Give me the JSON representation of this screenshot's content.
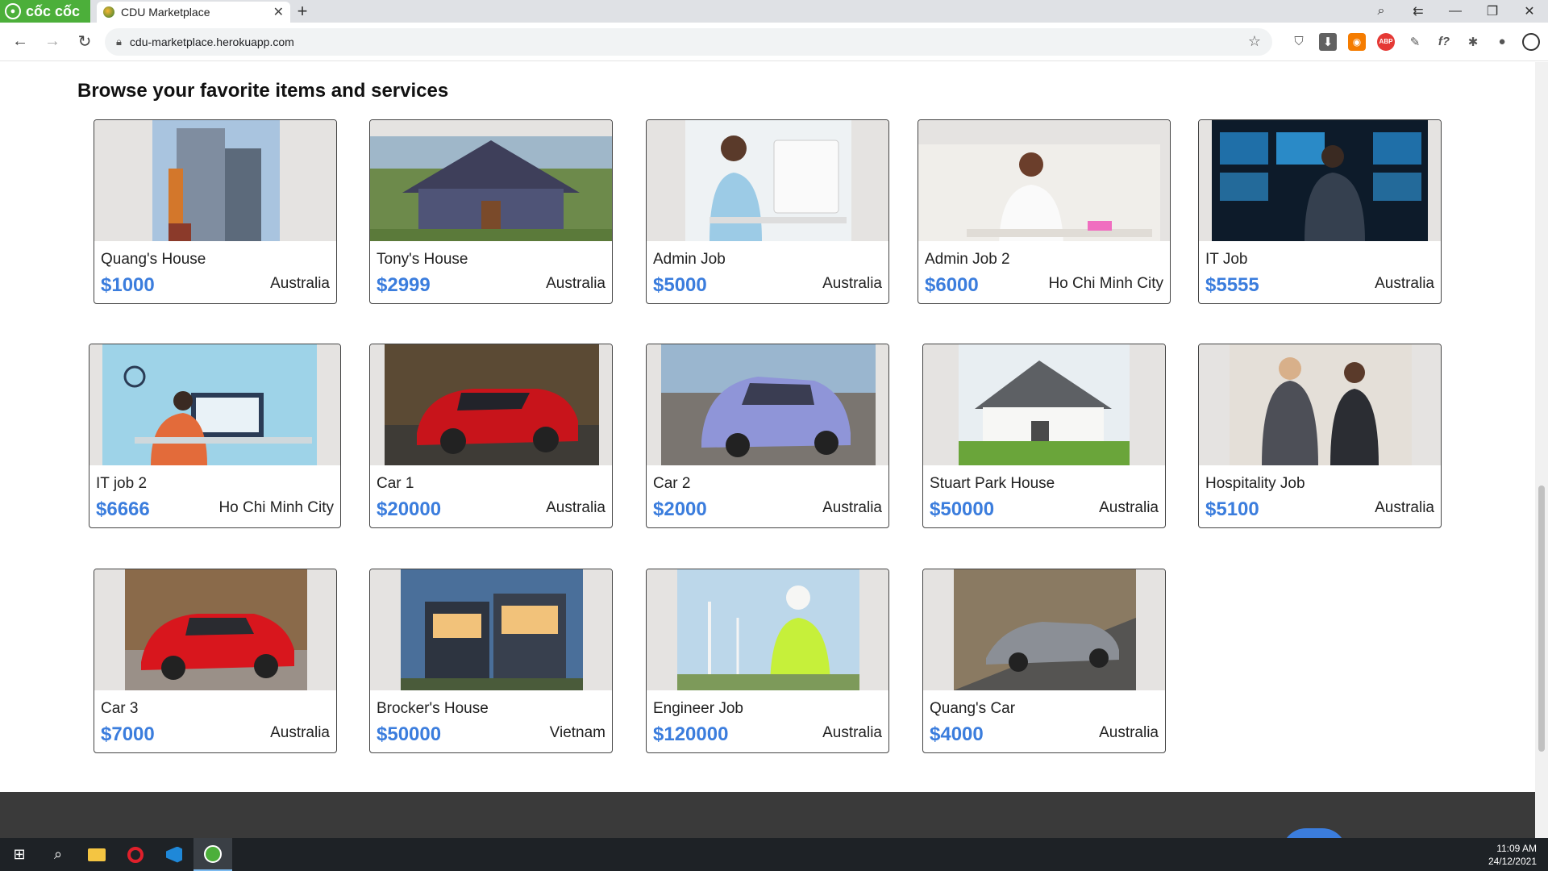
{
  "browser": {
    "brand": "cốc cốc",
    "tab_title": "CDU Marketplace",
    "url": "cdu-marketplace.herokuapp.com"
  },
  "page": {
    "heading": "Browse your favorite items and services"
  },
  "listings": [
    {
      "name": "Quang's House",
      "price": "$1000",
      "location": "Australia"
    },
    {
      "name": "Tony's House",
      "price": "$2999",
      "location": "Australia"
    },
    {
      "name": "Admin Job",
      "price": "$5000",
      "location": "Australia"
    },
    {
      "name": "Admin Job 2",
      "price": "$6000",
      "location": "Ho Chi Minh City"
    },
    {
      "name": "IT Job",
      "price": "$5555",
      "location": "Australia"
    },
    {
      "name": "IT job 2",
      "price": "$6666",
      "location": "Ho Chi Minh City"
    },
    {
      "name": "Car 1",
      "price": "$20000",
      "location": "Australia"
    },
    {
      "name": "Car 2",
      "price": "$2000",
      "location": "Australia"
    },
    {
      "name": "Stuart Park House",
      "price": "$50000",
      "location": "Australia"
    },
    {
      "name": "Hospitality Job",
      "price": "$5100",
      "location": "Australia"
    },
    {
      "name": "Car 3",
      "price": "$7000",
      "location": "Australia"
    },
    {
      "name": "Brocker's House",
      "price": "$50000",
      "location": "Vietnam"
    },
    {
      "name": "Engineer Job",
      "price": "$120000",
      "location": "Australia"
    },
    {
      "name": "Quang's Car",
      "price": "$4000",
      "location": "Australia"
    }
  ],
  "taskbar": {
    "time": "11:09 AM",
    "date": "24/12/2021"
  },
  "colors": {
    "price": "#3b7ddd",
    "brand": "#4caf3a",
    "footer": "#3a3a3a"
  }
}
